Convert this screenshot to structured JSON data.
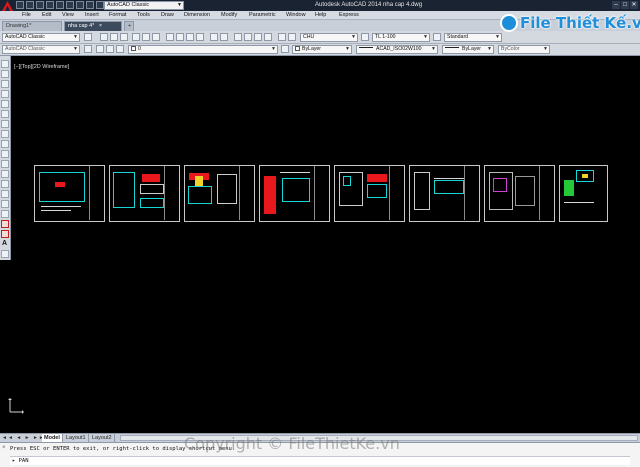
{
  "titlebar": {
    "workspace": "AutoCAD Classic",
    "app_title": "Autodesk AutoCAD 2014    nha cap 4.dwg",
    "minimize": "–",
    "maximize": "□",
    "close": "✕"
  },
  "menu": [
    "File",
    "Edit",
    "View",
    "Insert",
    "Format",
    "Tools",
    "Draw",
    "Dimension",
    "Modify",
    "Parametric",
    "Window",
    "Help",
    "Express"
  ],
  "doc_tabs": [
    {
      "label": "Drawing1*",
      "active": false
    },
    {
      "label": "nha cap 4*",
      "active": true
    }
  ],
  "tab_close": "×",
  "toolbar": {
    "workspace_select": "AutoCAD Classic",
    "layer_select": "0",
    "text_style": "CHU",
    "dim_style": "TL 1-100",
    "table_style": "Standard",
    "layer_color": "ByLayer",
    "linetype": "ByLayer",
    "lineweight_label": "ACAD_ISO02W100",
    "plot_color": "ByColor"
  },
  "viewport": {
    "label": "[−][Top][2D Wireframe]"
  },
  "layout_tabs": [
    "Model",
    "Layout1",
    "Layout2"
  ],
  "command": {
    "history": "Press ESC or ENTER to exit, or right-click to display shortcut menu.",
    "input": "PAN"
  },
  "watermark": {
    "logo_text": "File Thiết Kế.vn",
    "copyright": "Copyright © FileThietKe.vn"
  },
  "colors": {
    "drawing_bg": "#000000",
    "cyan": "#18d6d6",
    "red": "#e8181c",
    "yellow": "#f0d22a",
    "green": "#24c838",
    "brand_blue": "#1f8fd9"
  },
  "icons": {
    "app": "autocad-a-icon",
    "ucs": "ucs-icon"
  }
}
